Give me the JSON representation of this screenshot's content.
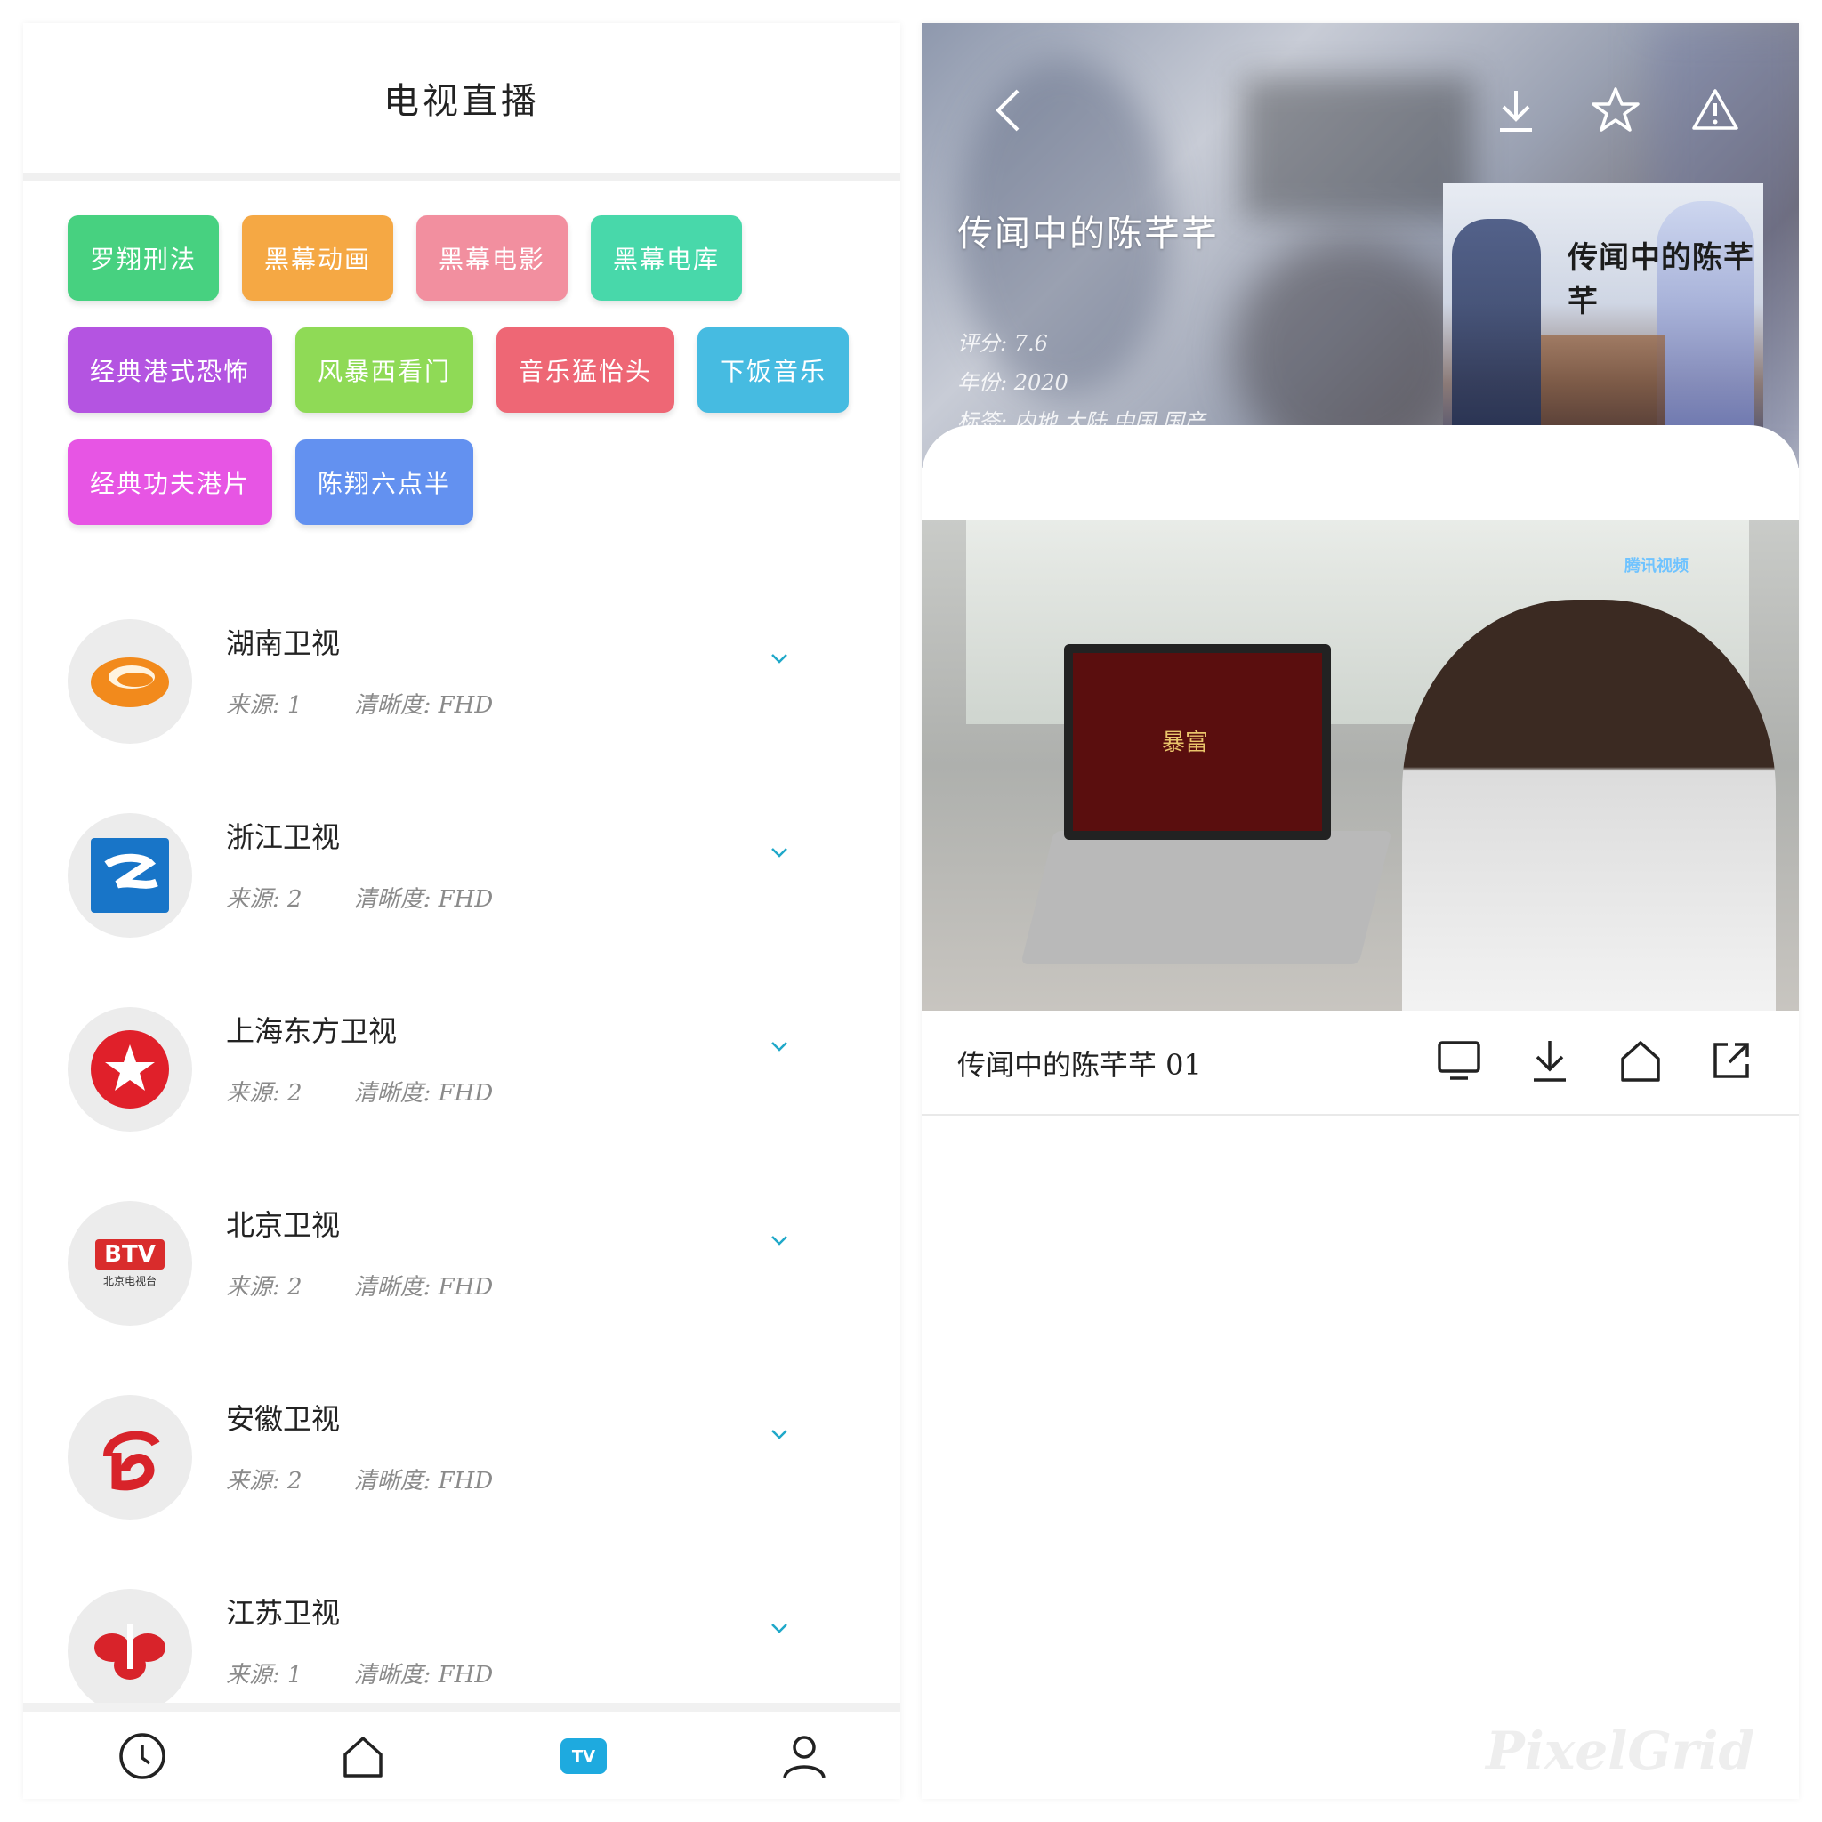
{
  "left": {
    "title": "电视直播",
    "tags": [
      {
        "label": "罗翔刑法",
        "color": "#3ecf7a"
      },
      {
        "label": "黑幕动画",
        "color": "#f5a43a"
      },
      {
        "label": "黑幕电影",
        "color": "#f28a9a"
      },
      {
        "label": "黑幕电库",
        "color": "#3fd6a6"
      },
      {
        "label": "经典港式恐怖",
        "color": "#b14be0"
      },
      {
        "label": "风暴西看门",
        "color": "#8ad94e"
      },
      {
        "label": "音乐猛怡头",
        "color": "#ee5f6e"
      },
      {
        "label": "下饭音乐",
        "color": "#3db8e0"
      },
      {
        "label": "经典功夫港片",
        "color": "#e64ce3"
      },
      {
        "label": "陈翔六点半",
        "color": "#5b8cf0"
      }
    ],
    "channels": [
      {
        "name": "湖南卫视",
        "source": "来源: 1",
        "quality": "清晰度: FHD",
        "logo": "hunan-logo"
      },
      {
        "name": "浙江卫视",
        "source": "来源: 2",
        "quality": "清晰度: FHD",
        "logo": "zhejiang-logo"
      },
      {
        "name": "上海东方卫视",
        "source": "来源: 2",
        "quality": "清晰度: FHD",
        "logo": "dragon-tv-logo"
      },
      {
        "name": "北京卫视",
        "source": "来源: 2",
        "quality": "清晰度: FHD",
        "logo": "btv-logo",
        "logo_text": "BTV",
        "logo_sub": "北京电视台"
      },
      {
        "name": "安徽卫视",
        "source": "来源: 2",
        "quality": "清晰度: FHD",
        "logo": "anhui-logo"
      },
      {
        "name": "江苏卫视",
        "source": "来源: 1",
        "quality": "清晰度: FHD",
        "logo": "jiangsu-logo"
      }
    ],
    "nav": [
      {
        "name": "clock-icon",
        "active": false
      },
      {
        "name": "home-icon",
        "active": false
      },
      {
        "name": "tv-icon",
        "active": true,
        "label": "TV"
      },
      {
        "name": "user-icon",
        "active": false
      }
    ],
    "accent": "#1eaadf"
  },
  "right": {
    "hero": {
      "title": "传闻中的陈芊芊",
      "rating": "评分: 7.6",
      "year": "年份: 2020",
      "tags": "标签: 内地 大陆 中国 国产",
      "poster_title": "传闻中的陈芊芊"
    },
    "video": {
      "screen_text": "暴富",
      "platform": "腾讯视频"
    },
    "episode": {
      "title": "传闻中的陈芊芊 01"
    },
    "watermark": "PixelGrid"
  }
}
